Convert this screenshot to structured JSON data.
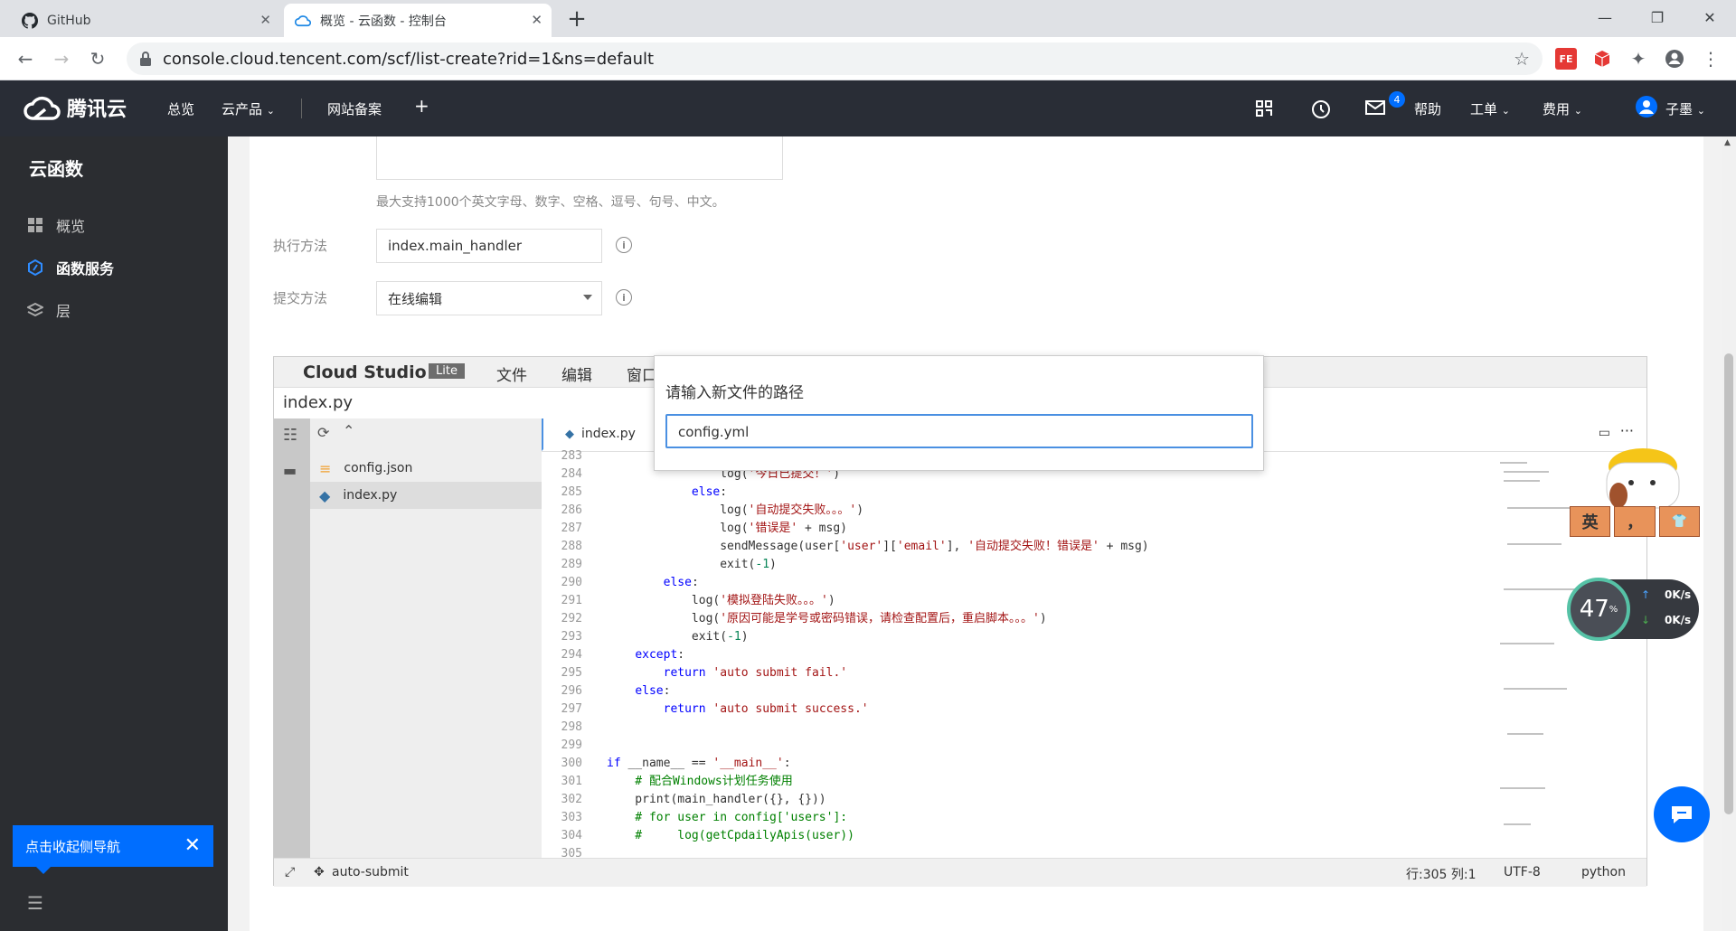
{
  "browser": {
    "tabs": [
      {
        "title": "GitHub",
        "icon": "github-icon"
      },
      {
        "title": "概览 - 云函数 - 控制台",
        "icon": "tencent-cloud-icon"
      }
    ],
    "url": "console.cloud.tencent.com/scf/list-create?rid=1&ns=default"
  },
  "header": {
    "brand": "腾讯云",
    "nav": [
      "总览",
      "云产品",
      "网站备案"
    ],
    "mail_badge": "4",
    "help": "帮助",
    "ticket": "工单",
    "billing": "费用",
    "user": "子墨"
  },
  "sidebar": {
    "title": "云函数",
    "items": [
      {
        "label": "概览",
        "icon": "grid-icon"
      },
      {
        "label": "函数服务",
        "icon": "function-icon",
        "active": true
      },
      {
        "label": "层",
        "icon": "layers-icon"
      }
    ],
    "collapse_tip": "点击收起侧导航"
  },
  "form": {
    "desc_hint": "最大支持1000个英文字母、数字、空格、逗号、句号、中文。",
    "handler_label": "执行方法",
    "handler_value": "index.main_handler",
    "submit_label": "提交方法",
    "submit_value": "在线编辑"
  },
  "ide": {
    "brand": "Cloud Studio",
    "badge": "Lite",
    "menu": [
      "文件",
      "编辑",
      "窗口"
    ],
    "path": "index.py",
    "files": [
      "config.json",
      "index.py"
    ],
    "tab": "index.py",
    "code": [
      {
        "n": "283",
        "t": ""
      },
      {
        "n": "284",
        "t": "                log('今日已提交！')"
      },
      {
        "n": "285",
        "t": "            else:"
      },
      {
        "n": "286",
        "t": "                log('自动提交失败。。。')"
      },
      {
        "n": "287",
        "t": "                log('错误是' + msg)"
      },
      {
        "n": "288",
        "t": "                sendMessage(user['user']['email'], '自动提交失败！错误是' + msg)"
      },
      {
        "n": "289",
        "t": "                exit(-1)"
      },
      {
        "n": "290",
        "t": "        else:"
      },
      {
        "n": "291",
        "t": "            log('模拟登陆失败。。。')"
      },
      {
        "n": "292",
        "t": "            log('原因可能是学号或密码错误，请检查配置后，重启脚本。。。')"
      },
      {
        "n": "293",
        "t": "            exit(-1)"
      },
      {
        "n": "294",
        "t": "    except:"
      },
      {
        "n": "295",
        "t": "        return 'auto submit fail.'"
      },
      {
        "n": "296",
        "t": "    else:"
      },
      {
        "n": "297",
        "t": "        return 'auto submit success.'"
      },
      {
        "n": "298",
        "t": ""
      },
      {
        "n": "299",
        "t": ""
      },
      {
        "n": "300",
        "t": "if __name__ == '__main__':"
      },
      {
        "n": "301",
        "t": "    # 配合Windows计划任务使用"
      },
      {
        "n": "302",
        "t": "    print(main_handler({}, {}))"
      },
      {
        "n": "303",
        "t": "    # for user in config['users']:"
      },
      {
        "n": "304",
        "t": "    #     log(getCpdailyApis(user))"
      },
      {
        "n": "305",
        "t": ""
      }
    ],
    "status_project": "auto-submit",
    "status_pos": "行:305 列:1",
    "status_enc": "UTF-8",
    "status_lang": "python"
  },
  "dialog": {
    "title": "请输入新文件的路径",
    "value": "config.yml"
  },
  "overlay": {
    "percent": "47",
    "unit": "%",
    "up": "0K/s",
    "down": "0K/s",
    "ime": [
      "英",
      "，",
      ""
    ]
  }
}
